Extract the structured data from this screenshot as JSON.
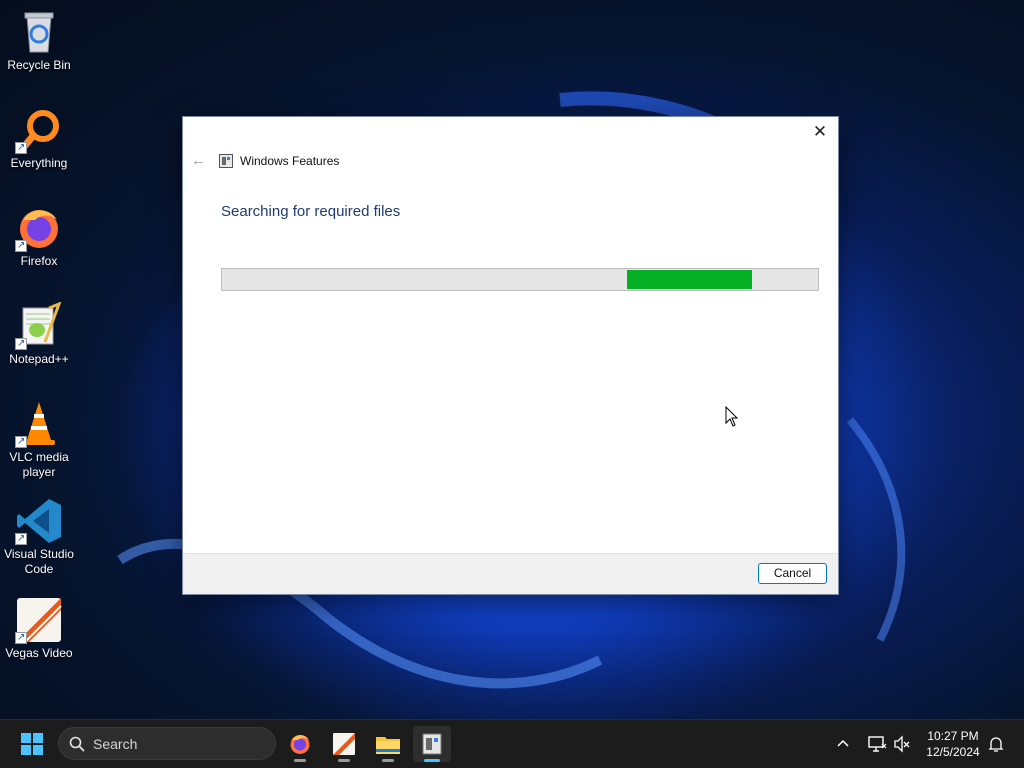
{
  "desktop": {
    "icons": [
      {
        "label": "Recycle Bin",
        "icon": "recycle-bin-icon"
      },
      {
        "label": "Everything",
        "icon": "everything-search-icon"
      },
      {
        "label": "Firefox",
        "icon": "firefox-icon"
      },
      {
        "label": "Notepad++",
        "icon": "notepad-plus-plus-icon"
      },
      {
        "label": "VLC media player",
        "icon": "vlc-cone-icon"
      },
      {
        "label": "Visual Studio Code",
        "icon": "vscode-icon"
      },
      {
        "label": "Vegas Video",
        "icon": "vegas-video-icon"
      }
    ]
  },
  "dialog": {
    "title": "Windows Features",
    "heading": "Searching for required files",
    "progress": {
      "start_fraction": 0.68,
      "end_fraction": 0.89,
      "color": "#06b025"
    },
    "cancel_label": "Cancel",
    "close_glyph": "✕",
    "back_glyph": "←"
  },
  "taskbar": {
    "search_placeholder": "Search",
    "apps": [
      "firefox-icon",
      "vegas-video-icon",
      "file-explorer-icon",
      "windows-features-icon"
    ],
    "time": "10:27 PM",
    "date": "12/5/2024",
    "accent": "#4cc2ff"
  }
}
